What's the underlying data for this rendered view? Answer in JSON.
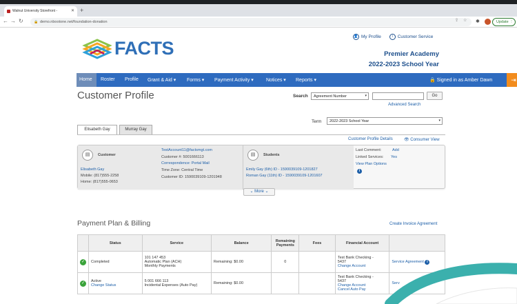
{
  "browser": {
    "tab_title": "Walnut University Storefront - ",
    "url": "demo.nbootone.net/foundation-donation",
    "update_label": "Update"
  },
  "header": {
    "logo_text": "FACTS",
    "my_profile": "My Profile",
    "customer_service": "Customer Service",
    "school_name": "Premier Academy",
    "school_year": "2022-2023 School Year"
  },
  "nav": {
    "items": [
      "Home",
      "Roster",
      "Profile",
      "Grant & Aid ▾",
      "Forms ▾",
      "Payment Activity ▾",
      "Notices ▾",
      "Reports ▾"
    ],
    "signed_in": "Signed in as Amber Dawn"
  },
  "page": {
    "title": "Customer Profile",
    "search_label": "Search",
    "search_type": "Agreement Number",
    "go_label": "Go",
    "advanced_search": "Advanced Search",
    "term_label": "Term",
    "term_value": "2022-2023 School Year",
    "tabs": [
      "Elisabeth Gay",
      "Murray Gay"
    ],
    "details_link": "Customer Profile Details",
    "consumer_view": "Consumer View"
  },
  "customer": {
    "heading": "Customer",
    "name": "Elisabeth Gay",
    "mobile": "Mobile: (817)555-2258",
    "home": "Home: (817)555-0653",
    "email": "TestAccount11@factsmgt.com",
    "customer_num": "Customer #: 5001666113",
    "correspondence": "Correspondence: Portal Mail",
    "timezone": "Time Zone: Central Time",
    "customer_id": "Customer ID: 1590039109-1201948"
  },
  "students": {
    "heading": "Students",
    "list": [
      "Emily Gay (6th) ID - 1590039109-1201827",
      "Roman Gay (11th) ID - 1590039109-1201607"
    ]
  },
  "side": {
    "last_comment": "Last Comment:",
    "add": "Add",
    "linked_services": "Linked Services:",
    "linked_value": "Yes",
    "view_plan_options": "View Plan Options"
  },
  "more_label": "More",
  "billing": {
    "title": "Payment Plan & Billing",
    "create_invoice": "Create Invoice Agreement",
    "columns": [
      "",
      "Status",
      "Service",
      "Balance",
      "Remaining Payments",
      "Fees",
      "Financial Account",
      ""
    ],
    "rows": [
      {
        "status": "Completed",
        "service_lines": [
          "101 147 453",
          "Automatic Plan (ACH)",
          "Monthly Payments"
        ],
        "balance": "Remaining:  $0.00",
        "remaining": "0",
        "fees": "",
        "account_lines": [
          "Test Bank Checking -",
          "5437"
        ],
        "account_link": "Change Account",
        "extra": "Service Agreement"
      },
      {
        "status": "Active",
        "status_link": "Change Status",
        "service_lines": [
          "5 001 666 113",
          "Incidental Expenses (Auto Pay)"
        ],
        "balance": "Remaining:  $0.00",
        "remaining": "",
        "fees": "",
        "account_lines": [
          "Test Bank Checking -",
          "5437"
        ],
        "account_link": "Change Account",
        "account_link2": "Cancel Auto Pay",
        "extra": "Serv"
      }
    ]
  },
  "colors": {
    "nav_blue": "#2e6bbf",
    "brand_blue": "#1d4f8c",
    "orange": "#f28c1d",
    "teal_swoosh": "#3bb0ad"
  }
}
